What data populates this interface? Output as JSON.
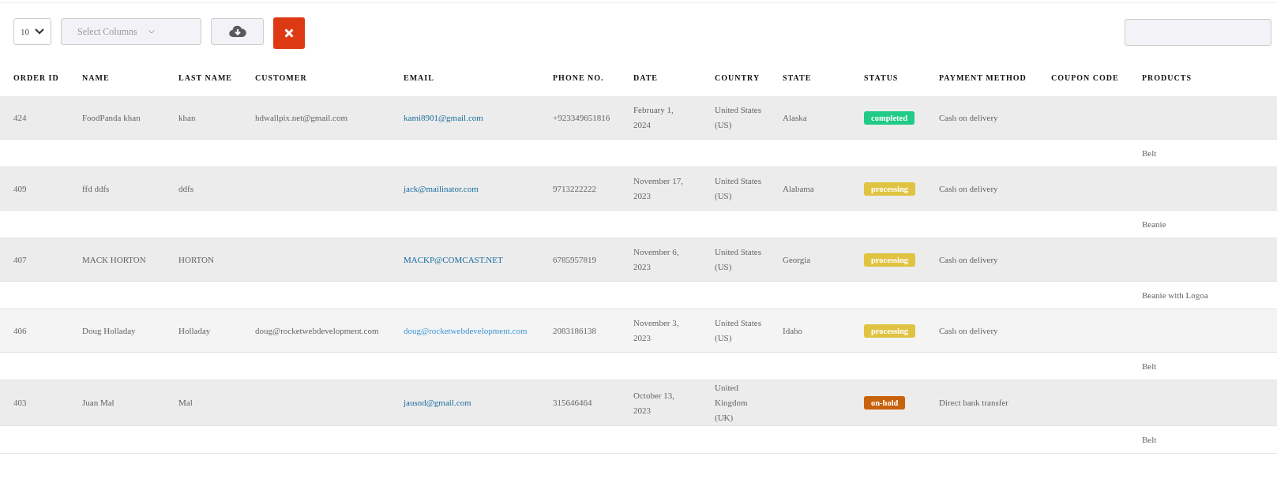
{
  "toolbar": {
    "page_size": "10",
    "columns_select": {
      "placeholder": "Select Columns"
    }
  },
  "table": {
    "columns": [
      "ORDER ID",
      "NAME",
      "LAST NAME",
      "CUSTOMER",
      "EMAIL",
      "PHONE NO.",
      "DATE",
      "COUNTRY",
      "STATE",
      "STATUS",
      "PAYMENT METHOD",
      "COUPON CODE",
      "PRODUCTS"
    ],
    "rows": [
      {
        "order_id": "424",
        "name": "FoodPanda khan",
        "last_name": "khan",
        "customer": "hdwallpix.net@gmail.com",
        "email": "kami8901@gmail.com",
        "phone": "+923349651816",
        "date": "February 1, 2024",
        "country": "United States (US)",
        "state": "Alaska",
        "status": {
          "label": "completed",
          "color": "#1fcb86"
        },
        "payment_method": "Cash on delivery",
        "highlighted": false,
        "products": "Belt"
      },
      {
        "order_id": "409",
        "name": "ffd ddfs",
        "last_name": "ddfs",
        "email": "jack@mailinator.com",
        "phone": "9713222222",
        "date": "November 17, 2023",
        "country": "United States (US)",
        "state": "Alabama",
        "status": {
          "label": "processing",
          "color": "#e0c341"
        },
        "payment_method": "Cash on delivery",
        "highlighted": false,
        "products": "Beanie"
      },
      {
        "order_id": "407",
        "name": "MACK HORTON",
        "last_name": "HORTON",
        "email": "MACKP@COMCAST.NET",
        "phone": "6785957819",
        "date": "November 6, 2023",
        "country": "United States (US)",
        "state": "Georgia",
        "status": {
          "label": "processing",
          "color": "#e0c341"
        },
        "payment_method": "Cash on delivery",
        "highlighted": false,
        "products": "Beanie with Logoa"
      },
      {
        "order_id": "406",
        "name": "Doug Holladay",
        "last_name": "Holladay",
        "customer": "doug@rocketwebdevelopment.com",
        "email": "doug@rocketwebdevelopment.com",
        "phone": "2083186138",
        "date": "November 3, 2023",
        "country": "United States (US)",
        "state": "Idaho",
        "status": {
          "label": "processing",
          "color": "#e0c341"
        },
        "payment_method": "Cash on delivery",
        "highlighted": true,
        "products": "Belt"
      },
      {
        "order_id": "403",
        "name": "Juan Mal",
        "last_name": "Mal",
        "email": "jausnd@gmail.com",
        "phone": "315646464",
        "date": "October 13, 2023",
        "country": "United Kingdom (UK)",
        "status": {
          "label": "on-hold",
          "color": "#c8620c"
        },
        "payment_method": "Direct bank transfer",
        "highlighted": false,
        "products": "Belt"
      }
    ]
  }
}
